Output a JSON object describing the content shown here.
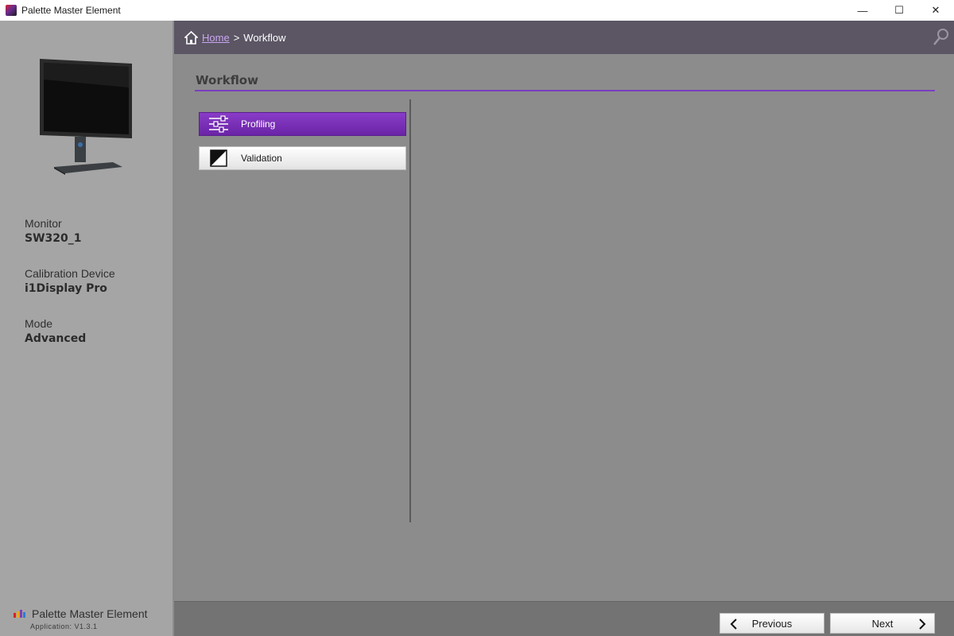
{
  "window": {
    "title": "Palette Master Element",
    "controls": {
      "minimize": "—",
      "maximize": "☐",
      "close": "✕"
    }
  },
  "sidebar": {
    "monitor_label": "Monitor",
    "monitor_value": "SW320_1",
    "device_label": "Calibration Device",
    "device_value": "i1Display Pro",
    "mode_label": "Mode",
    "mode_value": "Advanced",
    "brand_name": "Palette Master Element",
    "version": "Application: V1.3.1"
  },
  "breadcrumb": {
    "home": "Home",
    "separator": ">",
    "current": "Workflow"
  },
  "main": {
    "section_title": "Workflow",
    "items": [
      {
        "label": "Profiling",
        "icon": "sliders-icon",
        "active": true
      },
      {
        "label": "Validation",
        "icon": "contrast-icon",
        "active": false
      }
    ]
  },
  "footer": {
    "previous_label": "Previous",
    "next_label": "Next"
  },
  "colors": {
    "accent": "#7a3fc0",
    "header": "#5b5564",
    "link": "#c9a6f0"
  }
}
